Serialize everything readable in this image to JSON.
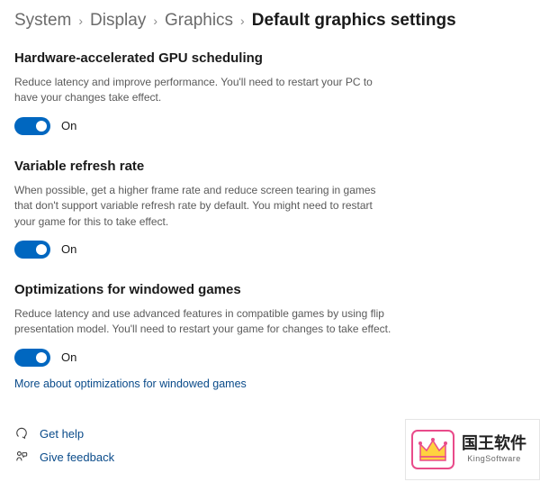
{
  "breadcrumb": {
    "items": [
      "System",
      "Display",
      "Graphics",
      "Default graphics settings"
    ],
    "active_index": 3
  },
  "sections": {
    "gpu_sched": {
      "title": "Hardware-accelerated GPU scheduling",
      "desc": "Reduce latency and improve performance. You'll need to restart your PC to have your changes take effect.",
      "toggle_state": "On"
    },
    "vrr": {
      "title": "Variable refresh rate",
      "desc": "When possible, get a higher frame rate and reduce screen tearing in games that don't support variable refresh rate by default. You might need to restart your game for this to take effect.",
      "toggle_state": "On"
    },
    "windowed": {
      "title": "Optimizations for windowed games",
      "desc": "Reduce latency and use advanced features in compatible games by using flip presentation model. You'll need to restart your game for changes to take effect.",
      "toggle_state": "On",
      "more_link": "More about optimizations for windowed games"
    }
  },
  "footer": {
    "get_help": "Get help",
    "give_feedback": "Give feedback"
  },
  "watermark": {
    "cn": "国王软件",
    "en": "KingSoftware"
  }
}
